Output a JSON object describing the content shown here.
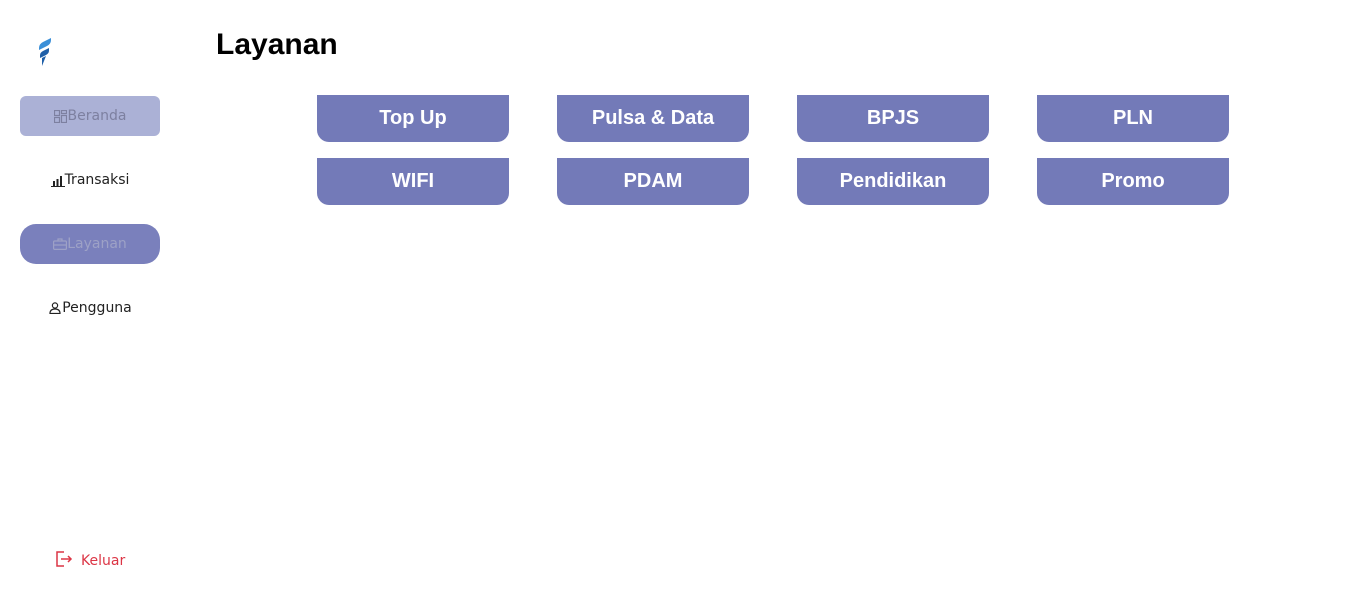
{
  "sidebar": {
    "logo_icon": "brand-logo-icon",
    "items": [
      {
        "label": "Beranda",
        "icon": "grid-icon"
      },
      {
        "label": "Transaksi",
        "icon": "bar-chart-icon"
      },
      {
        "label": "Layanan",
        "icon": "briefcase-icon"
      },
      {
        "label": "Pengguna",
        "icon": "user-icon"
      }
    ],
    "logout": {
      "label": "Keluar",
      "icon": "logout-icon",
      "color": "#dc3545"
    }
  },
  "main": {
    "title": "Layanan",
    "services": [
      {
        "label": "Top Up"
      },
      {
        "label": "Pulsa & Data"
      },
      {
        "label": "BPJS"
      },
      {
        "label": "PLN"
      },
      {
        "label": "WIFI"
      },
      {
        "label": "PDAM"
      },
      {
        "label": "Pendidikan"
      },
      {
        "label": "Promo"
      }
    ]
  },
  "colors": {
    "service_button": "#737ab8",
    "nav_active": "#7a80bc",
    "nav_hover": "#abb1d6"
  }
}
